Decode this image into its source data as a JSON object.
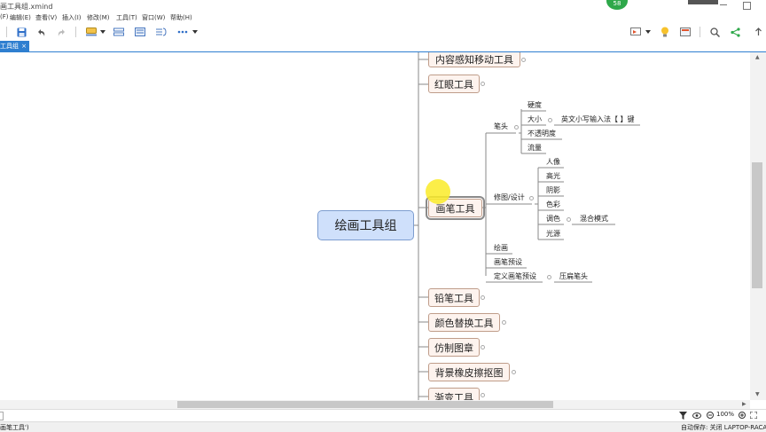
{
  "title": "画工具组.xmind",
  "badge": "58",
  "menu": [
    "(F)",
    "编辑(E)",
    "查看(V)",
    "插入(I)",
    "修改(M)",
    "工具(T)",
    "窗口(W)",
    "帮助(H)"
  ],
  "toolbar": {
    "left_icons": [
      "save-icon",
      "undo-icon",
      "redo-icon",
      "topic-icon",
      "dropdown-icon",
      "relationship-icon",
      "boundary-icon",
      "summary-icon",
      "more-icon",
      "dropdown-icon"
    ],
    "right_icons": [
      "presentation-icon",
      "dropdown-icon",
      "idea-icon",
      "picture-icon",
      "search-icon",
      "share-icon",
      "export-icon"
    ]
  },
  "tab": {
    "label": "工具组",
    "close": "×"
  },
  "map": {
    "root": "绘画工具组",
    "topics": [
      {
        "id": "t1",
        "label": "内容感知移动工具"
      },
      {
        "id": "t2",
        "label": "红眼工具"
      },
      {
        "id": "t3",
        "label": "画笔工具",
        "selected": true
      },
      {
        "id": "t4",
        "label": "铅笔工具"
      },
      {
        "id": "t5",
        "label": "颜色替换工具"
      },
      {
        "id": "t6",
        "label": "仿制图章"
      },
      {
        "id": "t7",
        "label": "背景橡皮擦抠图"
      },
      {
        "id": "t8",
        "label": "渐变工具"
      }
    ],
    "brush_children": {
      "bitou": "笔头",
      "bitou_children": [
        "硬度",
        "大小",
        "不透明度",
        "流量"
      ],
      "size_note": "英文小写输入法【 】键",
      "xiutu": "修图/设计",
      "xiutu_children": [
        "人像",
        "高光",
        "阴影",
        "色彩",
        "调色",
        "光源"
      ],
      "tiaose_note": "混合模式",
      "huihua": "绘画",
      "yushe": "画笔预设",
      "dingyi": "定义画笔预设",
      "dingyi_note": "压扁笔头"
    }
  },
  "status": {
    "left": "画笔工具')",
    "right": "自动保存: 关闭  LAPTOP-RACA",
    "zoom": "100%"
  }
}
